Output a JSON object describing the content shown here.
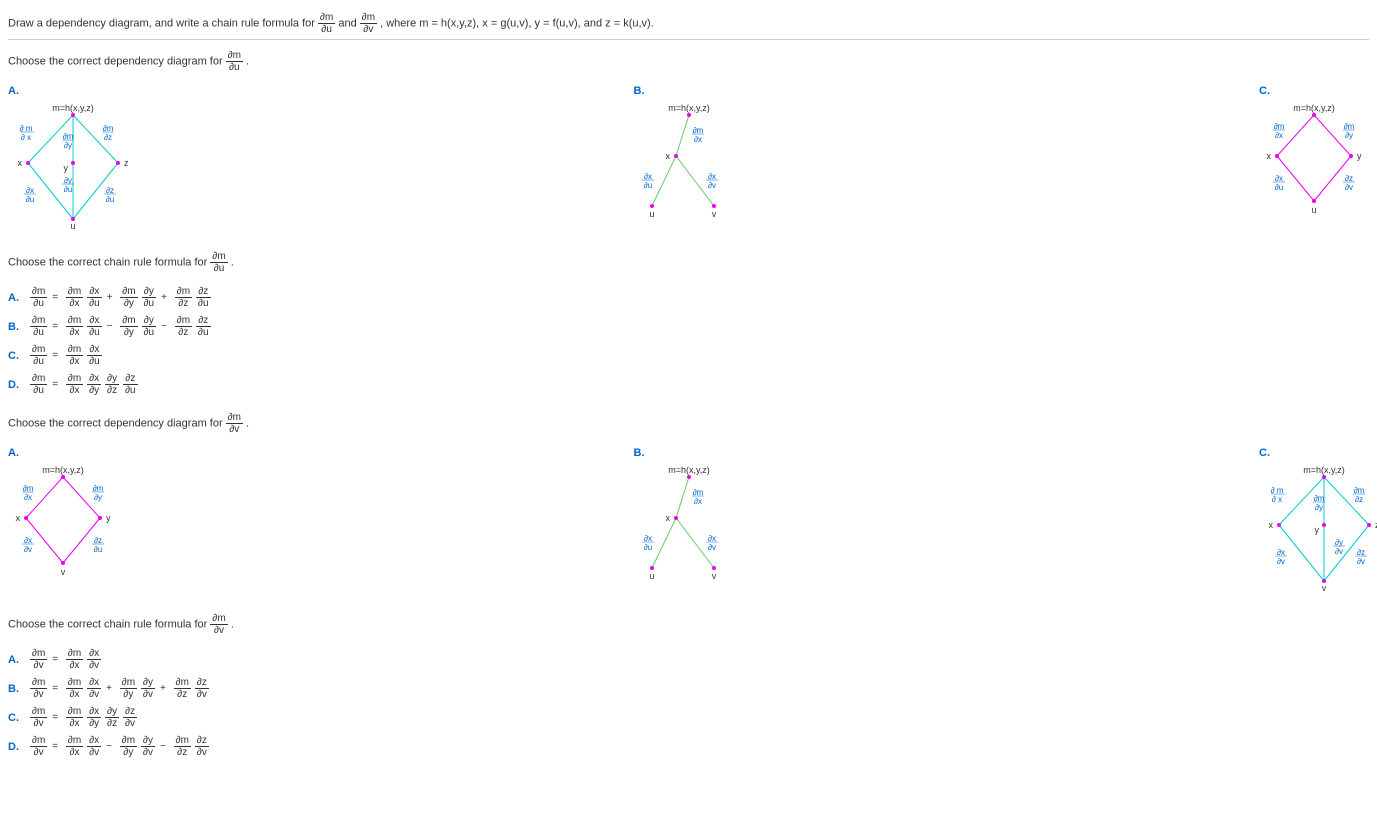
{
  "chart_data": {
    "type": "table",
    "note": "Math homework question about chain rule dependency diagrams",
    "function_definition": "m = h(x,y,z), x = g(u,v), y = f(u,v), z = k(u,v)",
    "derivatives_requested": [
      "∂m/∂u",
      "∂m/∂v"
    ]
  },
  "header": {
    "text_pre": "Draw a dependency diagram, and write a chain rule formula for ",
    "d1_num": "∂m",
    "d1_den": "∂u",
    "mid": " and ",
    "d2_num": "∂m",
    "d2_den": "∂v",
    "text_post": ", where m = h(x,y,z), x = g(u,v), y = f(u,v), and z = k(u,v)."
  },
  "sections": {
    "diag_u": {
      "prompt_pre": "Choose the correct dependency diagram for ",
      "frac_num": "∂m",
      "frac_den": "∂u",
      "prompt_post": "."
    },
    "formula_u": {
      "prompt_pre": "Choose the correct chain rule formula for ",
      "frac_num": "∂m",
      "frac_den": "∂u",
      "prompt_post": "."
    },
    "diag_v": {
      "prompt_pre": "Choose the correct dependency diagram for ",
      "frac_num": "∂m",
      "frac_den": "∂v",
      "prompt_post": "."
    },
    "formula_v": {
      "prompt_pre": "Choose the correct chain rule formula for ",
      "frac_num": "∂m",
      "frac_den": "∂v",
      "prompt_post": "."
    }
  },
  "opt_labels": {
    "a": "A.",
    "b": "B.",
    "c": "C.",
    "d": "D."
  },
  "diagram_labels": {
    "top": "m=h(x,y,z)",
    "x": "x",
    "y": "y",
    "z": "z",
    "u": "u",
    "v": "v",
    "dm_dx_n": "∂m",
    "dm_dx_d": "∂x",
    "dm_dy_n": "∂m",
    "dm_dy_d": "∂y",
    "dm_dz_n": "∂m",
    "dm_dz_d": "∂z",
    "dx_du_n": "∂x",
    "dx_du_d": "∂u",
    "dx_dv_n": "∂x",
    "dx_dv_d": "∂v",
    "dy_du_n": "∂y",
    "dy_du_d": "∂u",
    "dy_dv_n": "∂y",
    "dy_dv_d": "∂v",
    "dz_du_n": "∂z",
    "dz_du_d": "∂u",
    "dz_dv_n": "∂z",
    "dz_dv_d": "∂v",
    "d_m_n": "∂  m",
    "d_x_d": "∂ x"
  },
  "formulas_u": {
    "a": "∂m/∂u = ∂m/∂x · ∂x/∂u + ∂m/∂y · ∂y/∂u + ∂m/∂z · ∂z/∂u",
    "b": "∂m/∂u = ∂m/∂x · ∂x/∂u − ∂m/∂y · ∂y/∂u − ∂m/∂z · ∂z/∂u",
    "c": "∂m/∂u = ∂m/∂x · ∂x/∂u",
    "d": "∂m/∂u = ∂m/∂x · ∂x/∂y · ∂y/∂z · ∂z/∂u"
  },
  "formulas_v": {
    "a": "∂m/∂v = ∂m/∂x · ∂x/∂v",
    "b": "∂m/∂v = ∂m/∂x · ∂x/∂v + ∂m/∂y · ∂y/∂v + ∂m/∂z · ∂z/∂v",
    "c": "∂m/∂v = ∂m/∂x · ∂x/∂y · ∂y/∂z · ∂z/∂v",
    "d": "∂m/∂v = ∂m/∂x · ∂x/∂v − ∂m/∂y · ∂y/∂v − ∂m/∂z · ∂z/∂v"
  }
}
